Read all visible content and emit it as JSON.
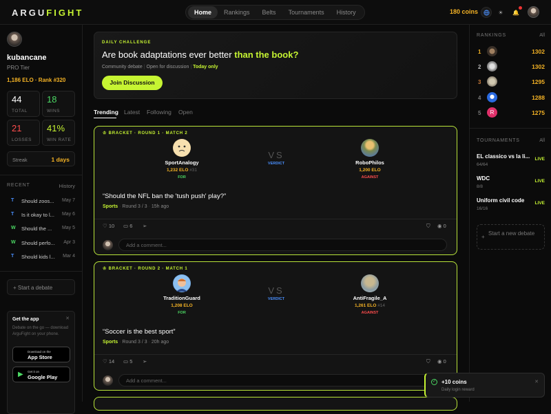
{
  "app": {
    "logo_a": "ARGU",
    "logo_b": "FIGHT"
  },
  "nav": {
    "items": [
      "Home",
      "Rankings",
      "Belts",
      "Tournaments",
      "History"
    ]
  },
  "header": {
    "coins": "180 coins"
  },
  "profile": {
    "username": "kubancane",
    "tier": "PRO Tier",
    "elo_rank": "1,186 ELO  ·  Rank #320",
    "stats": [
      {
        "value": "44",
        "label": "TOTAL",
        "color": "#ffffff"
      },
      {
        "value": "18",
        "label": "WINS",
        "color": "#4cd964"
      },
      {
        "value": "21",
        "label": "LOSSES",
        "color": "#ff4d4d"
      },
      {
        "value": "41%",
        "label": "WIN RATE",
        "color": "#c6f432"
      }
    ],
    "streak_label": "Streak",
    "streak_value": "1 days"
  },
  "recent": {
    "title": "RECENT",
    "link": "History",
    "items": [
      {
        "badge": "T",
        "title": "Should zoos...",
        "date": "May 7"
      },
      {
        "badge": "T",
        "title": "Is it okay to l...",
        "date": "May 6"
      },
      {
        "badge": "W",
        "title": "Should the ...",
        "date": "May 5"
      },
      {
        "badge": "W",
        "title": "Should perfo...",
        "date": "Apr 3"
      },
      {
        "badge": "T",
        "title": "Should kids l...",
        "date": "Mar 4"
      }
    ]
  },
  "start_debate": "+ Start a debate",
  "get_app": {
    "title": "Get the app",
    "text": "Debate on the go — download ArguFight on your phone.",
    "appstore_small": "Download on the",
    "appstore_big": "App Store",
    "play_small": "Get it on",
    "play_big": "Google Play"
  },
  "daily": {
    "label": "DAILY CHALLENGE",
    "question_a": "Are book adaptations ever better ",
    "question_b": "than the book?",
    "meta_a": "Community debate",
    "meta_b": "Open for discussion",
    "meta_c": "Today only",
    "button": "Join Discussion"
  },
  "tabs": [
    "Trending",
    "Latest",
    "Following",
    "Open"
  ],
  "cards": [
    {
      "bracket": "BRACKET · ROUND 1 · MATCH 2",
      "p1": {
        "name": "SportAnalogy",
        "elo": "1,232 ELO",
        "seed": "#31",
        "side": "FOR"
      },
      "p2": {
        "name": "RoboPhilos",
        "elo": "1,200 ELO",
        "seed": "",
        "side": "AGAINST"
      },
      "vs": "VS",
      "status": "VERDICT",
      "question": "“Should the NFL ban the 'tush push' play?”",
      "category": "Sports",
      "round": "Round 3 / 3",
      "time": "15h ago",
      "likes": "10",
      "comments": "6",
      "views": "0",
      "comment_placeholder": "Add a comment..."
    },
    {
      "bracket": "BRACKET · ROUND 2 · MATCH 1",
      "p1": {
        "name": "TraditionGuard",
        "elo": "1,208 ELO",
        "seed": "",
        "side": "FOR"
      },
      "p2": {
        "name": "AntiFragile_A",
        "elo": "1,261 ELO",
        "seed": "#14",
        "side": "AGAINST"
      },
      "vs": "VS",
      "status": "VERDICT",
      "question": "“Soccer is the best sport”",
      "category": "Sports",
      "round": "Round 3 / 3",
      "time": "20h ago",
      "likes": "14",
      "comments": "5",
      "views": "0",
      "comment_placeholder": "Add a comment..."
    }
  ],
  "rankings": {
    "title": "RANKINGS",
    "link": "All",
    "items": [
      {
        "rank": "1",
        "score": "1302",
        "color": "#f5b325"
      },
      {
        "rank": "2",
        "score": "1302",
        "color": "#bbbbbb"
      },
      {
        "rank": "3",
        "score": "1295",
        "color": "#c87a3a"
      },
      {
        "rank": "4",
        "score": "1288",
        "color": "#777777"
      },
      {
        "rank": "5",
        "score": "1275",
        "color": "#777777",
        "initial": "R"
      }
    ]
  },
  "tournaments": {
    "title": "TOURNAMENTS",
    "link": "All",
    "items": [
      {
        "name": "EL classico vs la li...",
        "count": "64/64",
        "status": "LIVE"
      },
      {
        "name": "WDC",
        "count": "8/8",
        "status": "LIVE"
      },
      {
        "name": "Uniform civil code",
        "count": "16/16",
        "status": "LIVE"
      }
    ]
  },
  "new_debate": "Start a new debate",
  "toast": {
    "title": "+10 coins",
    "subtitle": "Daily login reward"
  }
}
